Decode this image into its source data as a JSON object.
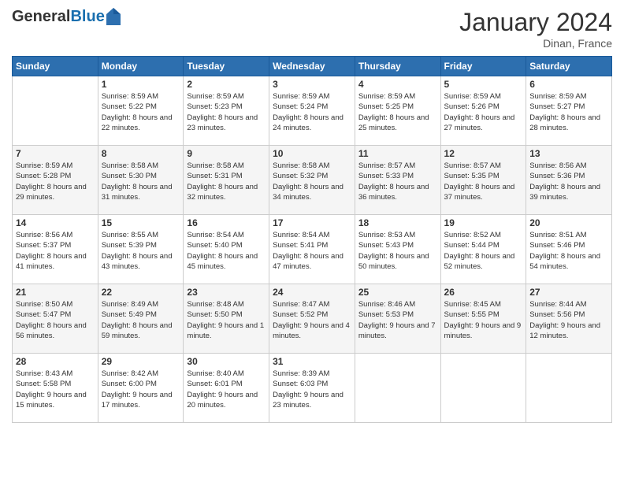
{
  "logo": {
    "general": "General",
    "blue": "Blue"
  },
  "title": "January 2024",
  "location": "Dinan, France",
  "headers": [
    "Sunday",
    "Monday",
    "Tuesday",
    "Wednesday",
    "Thursday",
    "Friday",
    "Saturday"
  ],
  "weeks": [
    [
      null,
      {
        "day": "1",
        "sunrise": "Sunrise: 8:59 AM",
        "sunset": "Sunset: 5:22 PM",
        "daylight": "Daylight: 8 hours and 22 minutes."
      },
      {
        "day": "2",
        "sunrise": "Sunrise: 8:59 AM",
        "sunset": "Sunset: 5:23 PM",
        "daylight": "Daylight: 8 hours and 23 minutes."
      },
      {
        "day": "3",
        "sunrise": "Sunrise: 8:59 AM",
        "sunset": "Sunset: 5:24 PM",
        "daylight": "Daylight: 8 hours and 24 minutes."
      },
      {
        "day": "4",
        "sunrise": "Sunrise: 8:59 AM",
        "sunset": "Sunset: 5:25 PM",
        "daylight": "Daylight: 8 hours and 25 minutes."
      },
      {
        "day": "5",
        "sunrise": "Sunrise: 8:59 AM",
        "sunset": "Sunset: 5:26 PM",
        "daylight": "Daylight: 8 hours and 27 minutes."
      },
      {
        "day": "6",
        "sunrise": "Sunrise: 8:59 AM",
        "sunset": "Sunset: 5:27 PM",
        "daylight": "Daylight: 8 hours and 28 minutes."
      }
    ],
    [
      {
        "day": "7",
        "sunrise": "Sunrise: 8:59 AM",
        "sunset": "Sunset: 5:28 PM",
        "daylight": "Daylight: 8 hours and 29 minutes."
      },
      {
        "day": "8",
        "sunrise": "Sunrise: 8:58 AM",
        "sunset": "Sunset: 5:30 PM",
        "daylight": "Daylight: 8 hours and 31 minutes."
      },
      {
        "day": "9",
        "sunrise": "Sunrise: 8:58 AM",
        "sunset": "Sunset: 5:31 PM",
        "daylight": "Daylight: 8 hours and 32 minutes."
      },
      {
        "day": "10",
        "sunrise": "Sunrise: 8:58 AM",
        "sunset": "Sunset: 5:32 PM",
        "daylight": "Daylight: 8 hours and 34 minutes."
      },
      {
        "day": "11",
        "sunrise": "Sunrise: 8:57 AM",
        "sunset": "Sunset: 5:33 PM",
        "daylight": "Daylight: 8 hours and 36 minutes."
      },
      {
        "day": "12",
        "sunrise": "Sunrise: 8:57 AM",
        "sunset": "Sunset: 5:35 PM",
        "daylight": "Daylight: 8 hours and 37 minutes."
      },
      {
        "day": "13",
        "sunrise": "Sunrise: 8:56 AM",
        "sunset": "Sunset: 5:36 PM",
        "daylight": "Daylight: 8 hours and 39 minutes."
      }
    ],
    [
      {
        "day": "14",
        "sunrise": "Sunrise: 8:56 AM",
        "sunset": "Sunset: 5:37 PM",
        "daylight": "Daylight: 8 hours and 41 minutes."
      },
      {
        "day": "15",
        "sunrise": "Sunrise: 8:55 AM",
        "sunset": "Sunset: 5:39 PM",
        "daylight": "Daylight: 8 hours and 43 minutes."
      },
      {
        "day": "16",
        "sunrise": "Sunrise: 8:54 AM",
        "sunset": "Sunset: 5:40 PM",
        "daylight": "Daylight: 8 hours and 45 minutes."
      },
      {
        "day": "17",
        "sunrise": "Sunrise: 8:54 AM",
        "sunset": "Sunset: 5:41 PM",
        "daylight": "Daylight: 8 hours and 47 minutes."
      },
      {
        "day": "18",
        "sunrise": "Sunrise: 8:53 AM",
        "sunset": "Sunset: 5:43 PM",
        "daylight": "Daylight: 8 hours and 50 minutes."
      },
      {
        "day": "19",
        "sunrise": "Sunrise: 8:52 AM",
        "sunset": "Sunset: 5:44 PM",
        "daylight": "Daylight: 8 hours and 52 minutes."
      },
      {
        "day": "20",
        "sunrise": "Sunrise: 8:51 AM",
        "sunset": "Sunset: 5:46 PM",
        "daylight": "Daylight: 8 hours and 54 minutes."
      }
    ],
    [
      {
        "day": "21",
        "sunrise": "Sunrise: 8:50 AM",
        "sunset": "Sunset: 5:47 PM",
        "daylight": "Daylight: 8 hours and 56 minutes."
      },
      {
        "day": "22",
        "sunrise": "Sunrise: 8:49 AM",
        "sunset": "Sunset: 5:49 PM",
        "daylight": "Daylight: 8 hours and 59 minutes."
      },
      {
        "day": "23",
        "sunrise": "Sunrise: 8:48 AM",
        "sunset": "Sunset: 5:50 PM",
        "daylight": "Daylight: 9 hours and 1 minute."
      },
      {
        "day": "24",
        "sunrise": "Sunrise: 8:47 AM",
        "sunset": "Sunset: 5:52 PM",
        "daylight": "Daylight: 9 hours and 4 minutes."
      },
      {
        "day": "25",
        "sunrise": "Sunrise: 8:46 AM",
        "sunset": "Sunset: 5:53 PM",
        "daylight": "Daylight: 9 hours and 7 minutes."
      },
      {
        "day": "26",
        "sunrise": "Sunrise: 8:45 AM",
        "sunset": "Sunset: 5:55 PM",
        "daylight": "Daylight: 9 hours and 9 minutes."
      },
      {
        "day": "27",
        "sunrise": "Sunrise: 8:44 AM",
        "sunset": "Sunset: 5:56 PM",
        "daylight": "Daylight: 9 hours and 12 minutes."
      }
    ],
    [
      {
        "day": "28",
        "sunrise": "Sunrise: 8:43 AM",
        "sunset": "Sunset: 5:58 PM",
        "daylight": "Daylight: 9 hours and 15 minutes."
      },
      {
        "day": "29",
        "sunrise": "Sunrise: 8:42 AM",
        "sunset": "Sunset: 6:00 PM",
        "daylight": "Daylight: 9 hours and 17 minutes."
      },
      {
        "day": "30",
        "sunrise": "Sunrise: 8:40 AM",
        "sunset": "Sunset: 6:01 PM",
        "daylight": "Daylight: 9 hours and 20 minutes."
      },
      {
        "day": "31",
        "sunrise": "Sunrise: 8:39 AM",
        "sunset": "Sunset: 6:03 PM",
        "daylight": "Daylight: 9 hours and 23 minutes."
      },
      null,
      null,
      null
    ]
  ]
}
